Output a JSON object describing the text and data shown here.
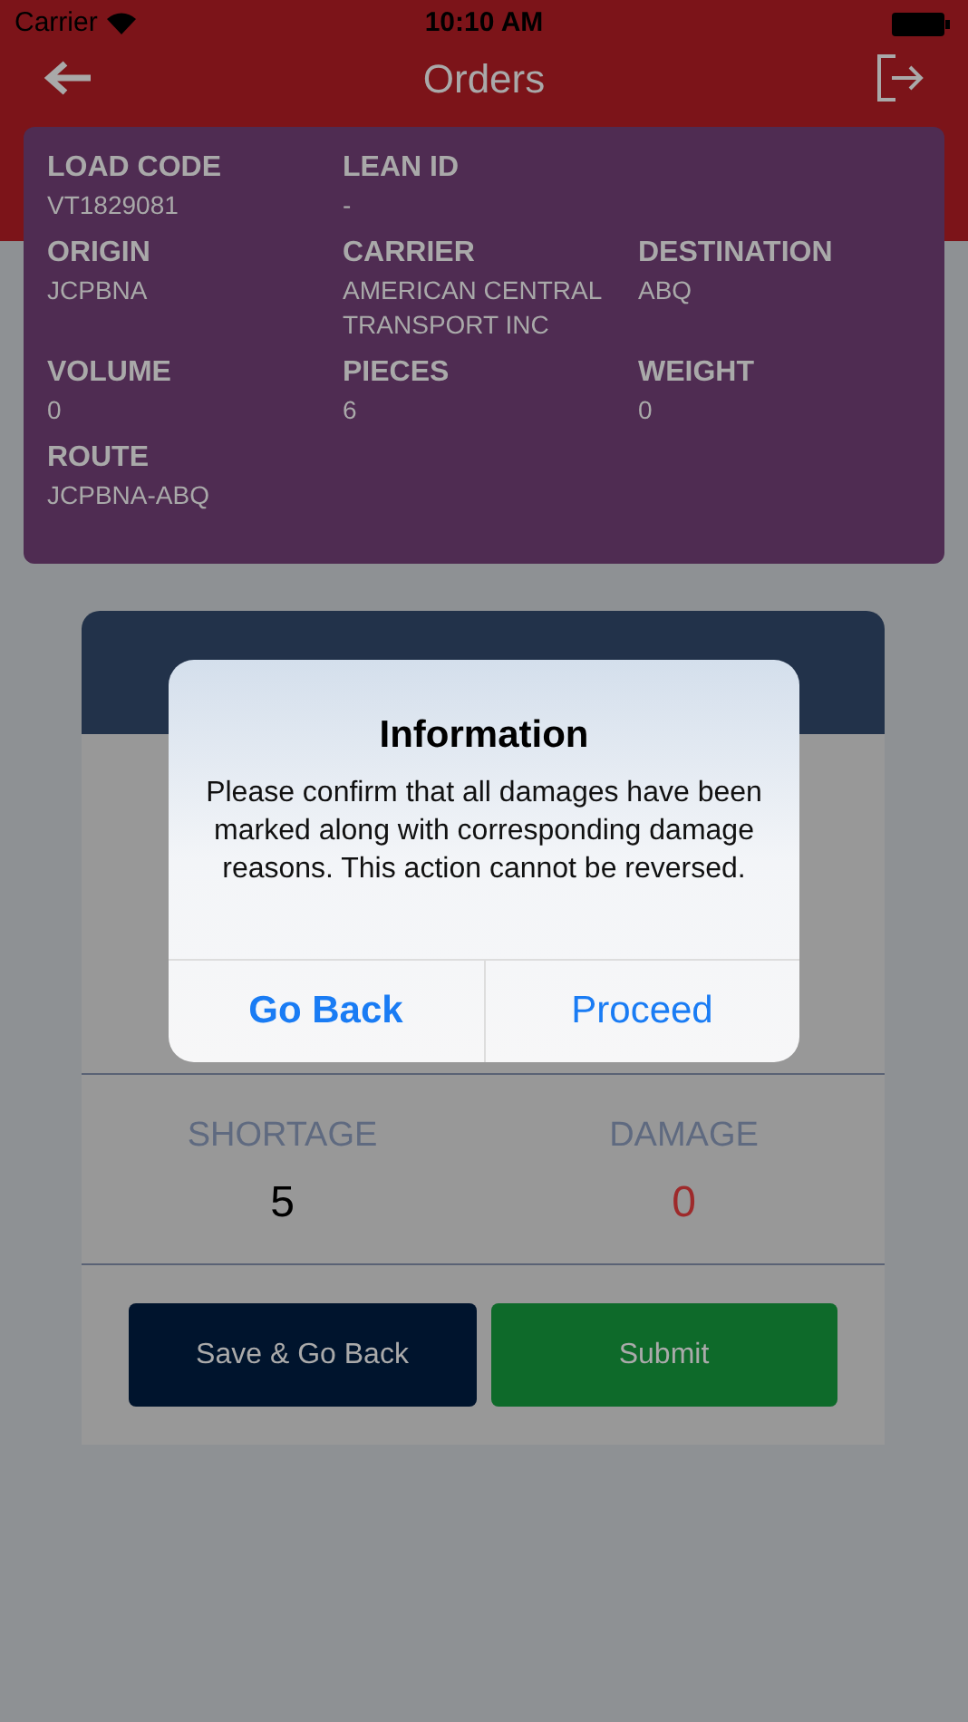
{
  "status_bar": {
    "carrier": "Carrier",
    "time": "10:10 AM"
  },
  "header": {
    "title": "Orders"
  },
  "load_info": {
    "rows": [
      [
        {
          "label": "LOAD CODE",
          "value": "VT1829081"
        },
        {
          "label": "LEAN ID",
          "value": "-"
        }
      ],
      [
        {
          "label": "ORIGIN",
          "value": "JCPBNA"
        },
        {
          "label": "CARRIER",
          "value": "AMERICAN CENTRAL TRANSPORT INC"
        },
        {
          "label": "DESTINATION",
          "value": "ABQ"
        }
      ],
      [
        {
          "label": "VOLUME",
          "value": "0"
        },
        {
          "label": "PIECES",
          "value": "6"
        },
        {
          "label": "WEIGHT",
          "value": "0"
        }
      ],
      [
        {
          "label": "ROUTE",
          "value": "JCPBNA-ABQ"
        }
      ]
    ]
  },
  "summary": [
    {
      "label": "SHORTAGE",
      "value": "5",
      "color": "#000000"
    },
    {
      "label": "DAMAGE",
      "value": "0",
      "color": "#9e2a2b"
    }
  ],
  "actions": [
    {
      "label": "Save & Go Back",
      "kind": "secondary"
    },
    {
      "label": "Submit",
      "kind": "primary"
    }
  ],
  "dialog": {
    "title": "Information",
    "message": "Please confirm that all damages have been marked along with corresponding damage reasons. This action cannot be reversed.",
    "buttons": [
      {
        "label": "Go Back",
        "kind": "bold"
      },
      {
        "label": "Proceed",
        "kind": "normal"
      }
    ]
  }
}
